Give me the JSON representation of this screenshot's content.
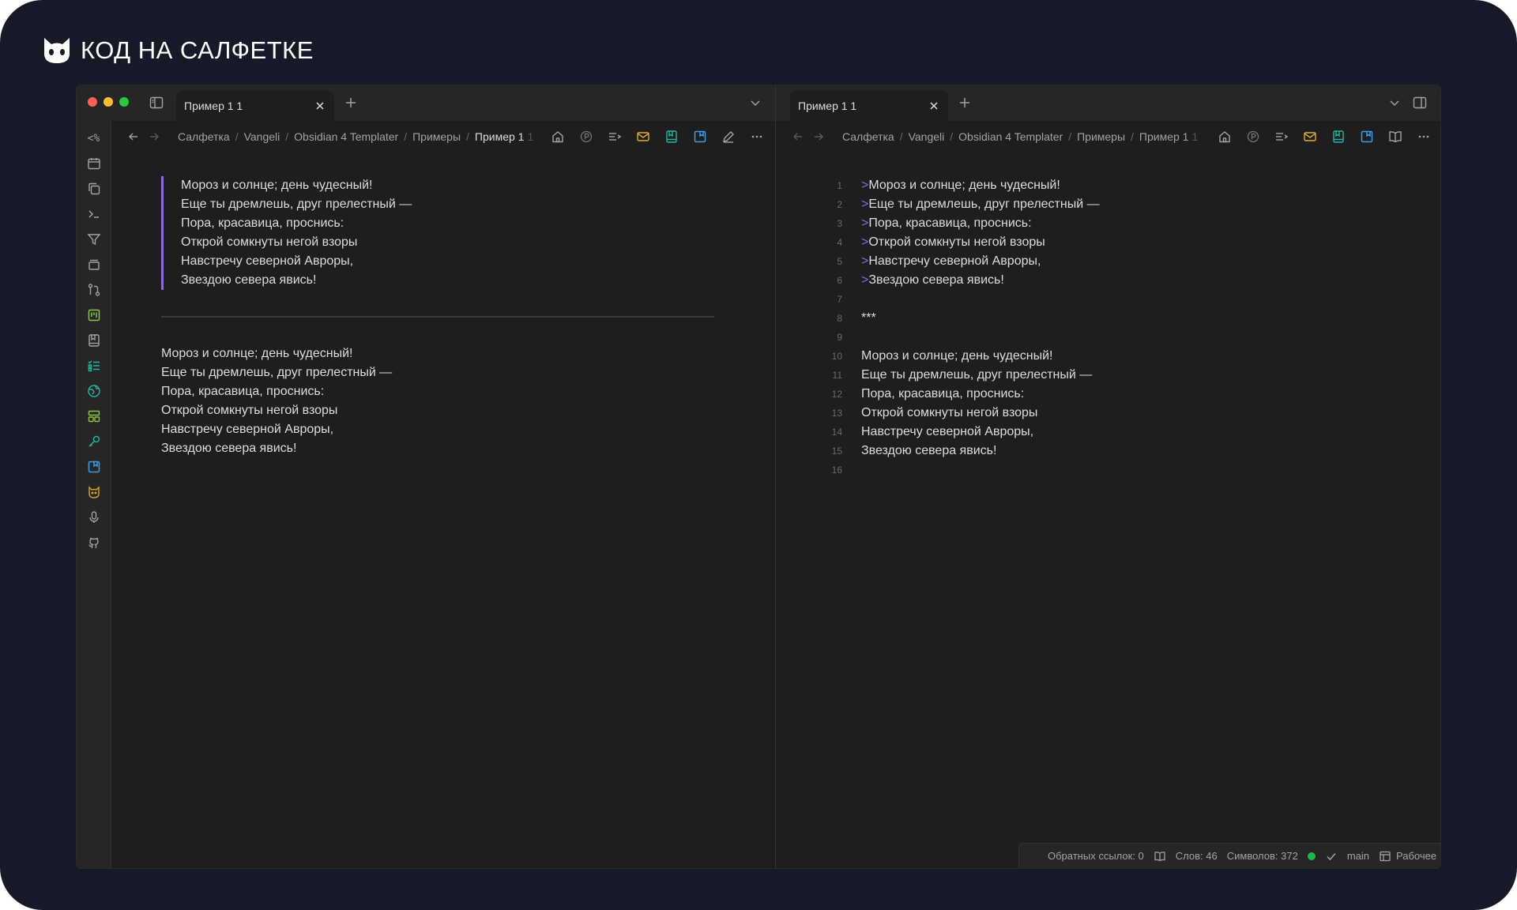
{
  "brand": {
    "name": "КОД НА САЛФЕТКЕ"
  },
  "colors": {
    "background": "#161a28",
    "window": "#1e1e1e",
    "chrome": "#262626",
    "accent_purple": "#8b6cdb",
    "traffic_red": "#ff5f57",
    "traffic_yellow": "#febc2e",
    "traffic_green": "#28c840",
    "sync_green": "#1fb84a"
  },
  "ribbon": {
    "icons": [
      "code-percent-icon",
      "calendar-icon",
      "copy-icon",
      "terminal-icon",
      "filter-icon",
      "layers-icon",
      "git-compare-icon",
      "kanban-icon",
      "bookmark-book-icon",
      "checklist-icon",
      "globe-icon",
      "dashboard-icon",
      "key-icon",
      "bookmark-blue-icon",
      "cat-icon",
      "microphone-icon",
      "github-icon"
    ],
    "first_glyph": "<%"
  },
  "left_pane": {
    "tab_title": "Пример 1 1",
    "breadcrumb": [
      "Салфетка",
      "Vangeli",
      "Obsidian 4 Templater",
      "Примеры"
    ],
    "breadcrumb_current": "Пример 1",
    "breadcrumb_trailing": "1",
    "quote_lines": [
      "Мороз и солнце; день чудесный!",
      "Еще ты дремлешь, друг прелестный —",
      "Пора, красавица, проснись:",
      "Открой сомкнуты негой взоры",
      "Навстречу северной Авроры,",
      "Звездою севера явись!"
    ],
    "plain_lines": [
      "Мороз и солнце; день чудесный!",
      "Еще ты дремлешь, друг прелестный —",
      "Пора, красавица, проснись:",
      "Открой сомкнуты негой взоры",
      "Навстречу северной Авроры,",
      "Звездою севера явись!"
    ]
  },
  "right_pane": {
    "tab_title": "Пример 1 1",
    "breadcrumb": [
      "Салфетка",
      "Vangeli",
      "Obsidian 4 Templater",
      "Примеры"
    ],
    "breadcrumb_current": "Пример 1",
    "breadcrumb_trailing": "1",
    "source_lines": [
      {
        "n": "1",
        "prefix": ">",
        "text": "Мороз и солнце; день чудесный!"
      },
      {
        "n": "2",
        "prefix": ">",
        "text": "Еще ты дремлешь, друг прелестный —"
      },
      {
        "n": "3",
        "prefix": ">",
        "text": "Пора, красавица, проснись:"
      },
      {
        "n": "4",
        "prefix": ">",
        "text": "Открой сомкнуты негой взоры"
      },
      {
        "n": "5",
        "prefix": ">",
        "text": "Навстречу северной Авроры,"
      },
      {
        "n": "6",
        "prefix": ">",
        "text": "Звездою севера явись!"
      },
      {
        "n": "7",
        "prefix": "",
        "text": ""
      },
      {
        "n": "8",
        "prefix": "",
        "text": "***"
      },
      {
        "n": "9",
        "prefix": "",
        "text": ""
      },
      {
        "n": "10",
        "prefix": "",
        "text": "Мороз и солнце; день чудесный!"
      },
      {
        "n": "11",
        "prefix": "",
        "text": "Еще ты дремлешь, друг прелестный —"
      },
      {
        "n": "12",
        "prefix": "",
        "text": "Пора, красавица, проснись:"
      },
      {
        "n": "13",
        "prefix": "",
        "text": "Открой сомкнуты негой взоры"
      },
      {
        "n": "14",
        "prefix": "",
        "text": "Навстречу северной Авроры,"
      },
      {
        "n": "15",
        "prefix": "",
        "text": "Звездою севера явись!"
      },
      {
        "n": "16",
        "prefix": "",
        "text": ""
      }
    ]
  },
  "status": {
    "backlinks": "Обратных ссылок: 0",
    "words": "Слов: 46",
    "chars": "Символов: 372",
    "branch": "main",
    "workspace": "Рабочее"
  }
}
